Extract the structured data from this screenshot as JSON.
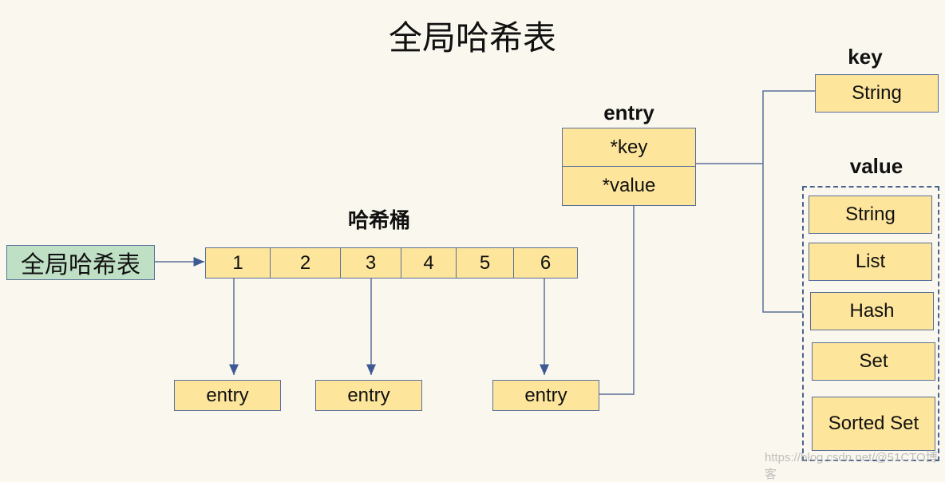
{
  "title": "全局哈希表",
  "global_table": {
    "label": "全局哈希表"
  },
  "buckets": {
    "heading": "哈希桶",
    "slots": [
      "1",
      "2",
      "3",
      "4",
      "5",
      "6"
    ]
  },
  "entries": [
    "entry",
    "entry",
    "entry"
  ],
  "entry_detail": {
    "heading": "entry",
    "fields": [
      "*key",
      "*value"
    ]
  },
  "key": {
    "heading": "key",
    "types": [
      "String"
    ]
  },
  "value": {
    "heading": "value",
    "types": [
      "String",
      "List",
      "Hash",
      "Set",
      "Sorted Set"
    ]
  },
  "watermark": "https://blog.csdn.net/@51CTO博客",
  "colors": {
    "background": "#faf8ee",
    "box_fill": "#fde59b",
    "global_fill": "#bfe0c5",
    "line": "#5a6f99"
  }
}
